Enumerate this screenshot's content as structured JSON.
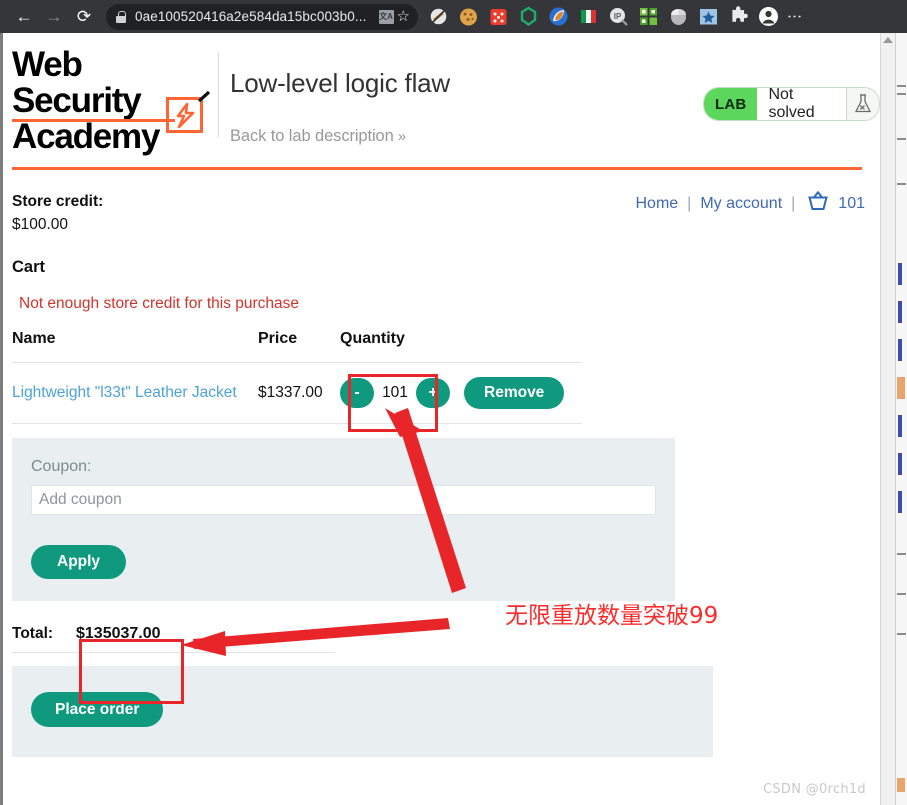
{
  "browser": {
    "back_icon": "back-arrow-icon",
    "forward_icon": "forward-arrow-icon",
    "reload_icon": "reload-icon",
    "url": "0ae100520416a2e584da15bc003b0...",
    "lock_icon": "lock-icon",
    "translate_icon": "translate-icon",
    "bookmark_icon": "star-icon",
    "menu_icon": "kebab-menu-icon",
    "extensions": [
      {
        "name": "no-script-extension-icon",
        "color": "#d8d8d8"
      },
      {
        "name": "cookie-editor-extension-icon",
        "color": "#e0a63f"
      },
      {
        "name": "dice-extension-icon",
        "color": "#ef3b2c"
      },
      {
        "name": "hexagon-extension-icon",
        "color": "#1fae67"
      },
      {
        "name": "fox-extension-icon",
        "color": "#2b6fd1"
      },
      {
        "name": "italy-flag-extension-icon",
        "color": "#0f9a4b"
      },
      {
        "name": "ip-lookup-extension-icon",
        "color": "#b9bcc0"
      },
      {
        "name": "qr-code-extension-icon",
        "color": "#74c043"
      },
      {
        "name": "mouse-extension-icon",
        "color": "#b7b7b7"
      },
      {
        "name": "star-bookmark-extension-icon",
        "color": "#1f5fa0"
      },
      {
        "name": "puzzle-extensions-icon",
        "color": "#e8eaed"
      },
      {
        "name": "profile-avatar-icon",
        "color": "#ffffff"
      }
    ]
  },
  "header": {
    "logo_line1": "Web Security",
    "logo_line2": "Academy",
    "logo_bolt_icon": "lightning-bolt-icon",
    "lab_title": "Low-level logic flaw",
    "back_link": "Back to lab description",
    "back_link_chevron": "»",
    "lab_badge": "LAB",
    "lab_state": "Not solved",
    "lab_flask_icon": "flask-icon"
  },
  "store": {
    "credit_label": "Store credit:",
    "credit_amount": "$100.00",
    "nav": {
      "home": "Home",
      "my_account": "My account",
      "separator": "|",
      "basket_icon": "shopping-basket-icon",
      "basket_count": "101"
    },
    "cart_heading": "Cart",
    "error_message": "Not enough store credit for this purchase",
    "table": {
      "columns": [
        "Name",
        "Price",
        "Quantity"
      ],
      "rows": [
        {
          "name": "Lightweight \"l33t\" Leather Jacket",
          "price": "$1337.00",
          "qty_minus": "-",
          "qty_value": "101",
          "qty_plus": "+",
          "remove_label": "Remove"
        }
      ]
    },
    "coupon": {
      "label": "Coupon:",
      "placeholder": "Add coupon",
      "value": "",
      "apply_label": "Apply"
    },
    "total_label": "Total:",
    "total_value": "$135037.00",
    "place_order_label": "Place order"
  },
  "annotations": {
    "note_cn": "无限重放数量突破99",
    "highlight_color": "#e8262a",
    "arrow_color": "#e8262a",
    "watermark": "CSDN @0rch1d"
  },
  "colors": {
    "accent_orange": "#ff6633",
    "button_teal": "#0f9a80",
    "link_blue": "#4169b2",
    "error_red": "#d0342c",
    "panel_grey": "#e9eff1",
    "lab_green": "#5cd65c"
  }
}
